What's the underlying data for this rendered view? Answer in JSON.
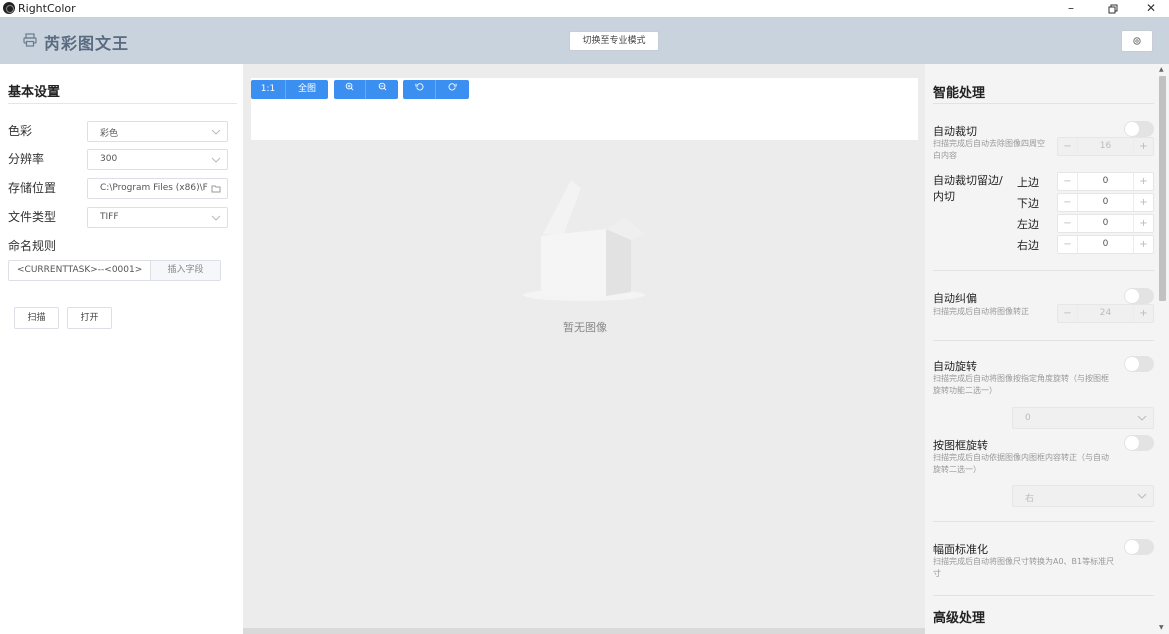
{
  "window": {
    "title": "RightColor"
  },
  "header": {
    "brand": "芮彩图文王",
    "mode_button": "切换至专业模式"
  },
  "basic": {
    "title": "基本设置",
    "color_label": "色彩",
    "color_value": "彩色",
    "resolution_label": "分辨率",
    "resolution_value": "300",
    "storage_label": "存储位置",
    "storage_value": "C:\\Program Files (x86)\\F",
    "filetype_label": "文件类型",
    "filetype_value": "TIFF",
    "naming_label": "命名规则",
    "naming_value": "<CURRENTTASK>--<0001>",
    "insert_field": "插入字段",
    "scan_button": "扫描",
    "open_button": "打开"
  },
  "toolbar": {
    "ratio_1_1": "1:1",
    "full": "全图"
  },
  "preview": {
    "empty_text": "暂无图像"
  },
  "smart": {
    "title": "智能处理",
    "auto_crop": {
      "label": "自动裁切",
      "desc": "扫描完成后自动去除图像四周空白内容",
      "value": "16"
    },
    "crop_margin": {
      "label_line1": "自动裁切留边/",
      "label_line2": "内切",
      "top_label": "上边",
      "top": "0",
      "bottom_label": "下边",
      "bottom": "0",
      "left_label": "左边",
      "left": "0",
      "right_label": "右边",
      "right": "0"
    },
    "deskew": {
      "label": "自动纠偏",
      "desc": "扫描完成后自动将图像转正",
      "value": "24"
    },
    "auto_rotate": {
      "label": "自动旋转",
      "desc": "扫描完成后自动将图像按指定角度旋转（与按图框旋转功能二选一）",
      "value": "0"
    },
    "frame_rotate": {
      "label": "按图框旋转",
      "desc": "扫描完成后自动依据图像内图框内容转正（与自动旋转二选一）",
      "value": "右"
    },
    "normalize": {
      "label": "幅面标准化",
      "desc": "扫描完成后自动将图像尺寸转换为A0、B1等标准尺寸"
    },
    "advanced_title": "高级处理"
  },
  "colors": {
    "header_bg": "#c8d3de",
    "accent": "#3b8ff0",
    "canvas": "#ececec",
    "panel": "#f4f4f4"
  }
}
